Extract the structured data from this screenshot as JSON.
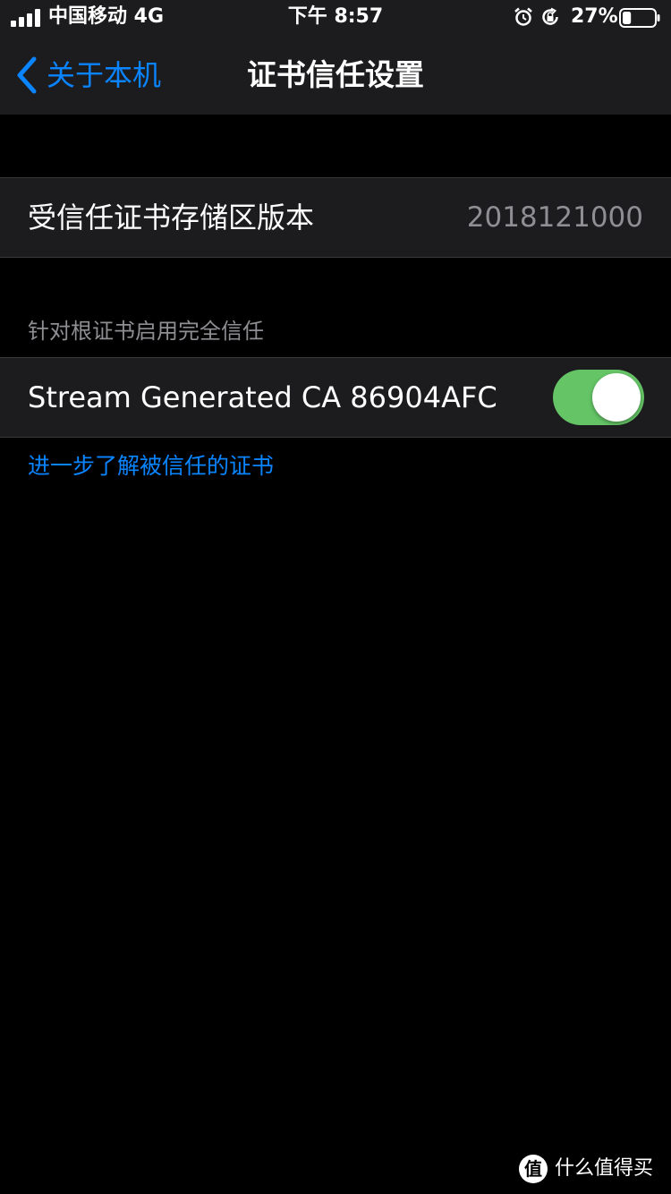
{
  "status_bar": {
    "carrier": "中国移动 4G",
    "time": "下午 8:57",
    "battery_percent": "27%",
    "battery_level": 0.27,
    "icons": [
      "signal-icon",
      "alarm-icon",
      "orientation-lock-icon",
      "battery-icon"
    ]
  },
  "nav": {
    "back_label": "关于本机",
    "title": "证书信任设置"
  },
  "trust_store": {
    "label": "受信任证书存储区版本",
    "value": "2018121000"
  },
  "root_trust": {
    "section_header": "针对根证书启用完全信任",
    "certificate_name": "Stream Generated CA 86904AFC",
    "enabled": true,
    "learn_more": "进一步了解被信任的证书"
  },
  "watermark": {
    "badge": "值",
    "text": "什么值得买"
  },
  "colors": {
    "accent": "#0a84ff",
    "toggle_on": "#65c466",
    "cell_bg": "#1c1c1e",
    "background": "#000000",
    "secondary_text": "#8e8e93"
  }
}
